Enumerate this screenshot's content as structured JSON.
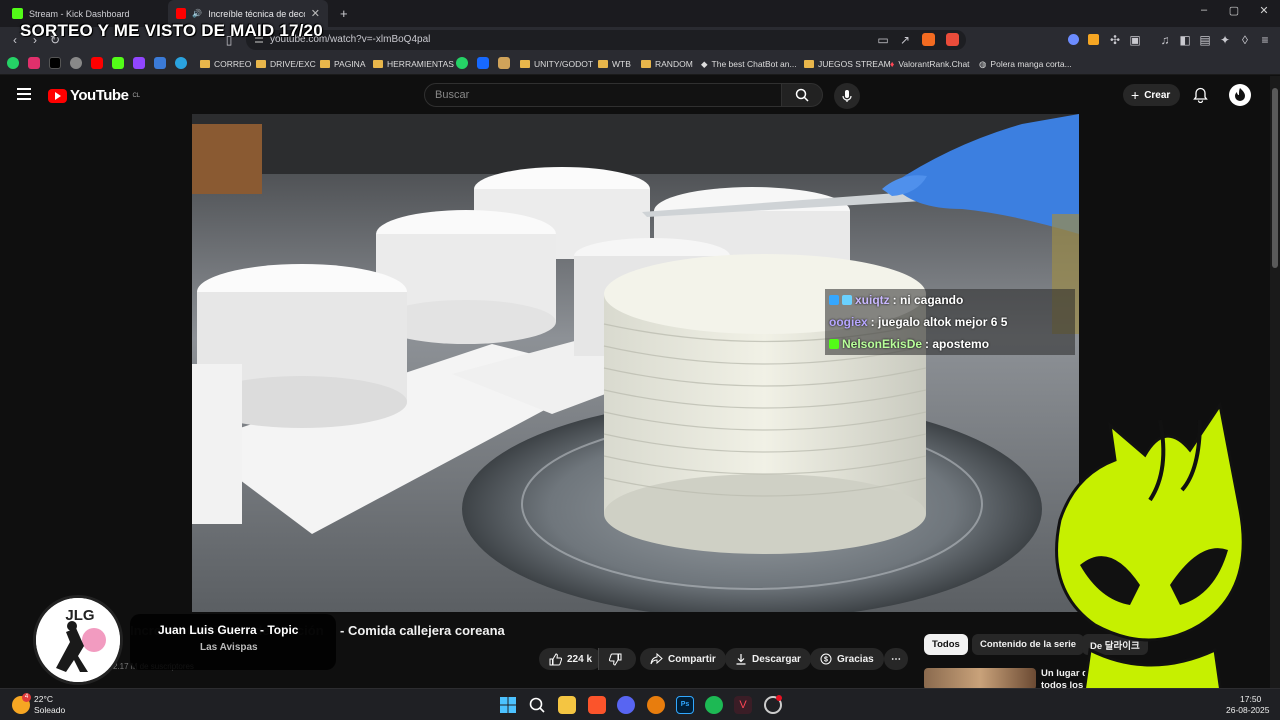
{
  "browser": {
    "tabs": [
      {
        "label": "Stream - Kick Dashboard",
        "favicon_color": "#53fc18"
      },
      {
        "label": "Increíble técnica de decoraci",
        "favicon_color": "#ff0000"
      }
    ],
    "new_tab": "+",
    "url": "youtube.com/watch?v=-xlmBoQ4pal",
    "window_controls": {
      "minimize": "–",
      "maximize": "▢",
      "close": "✕"
    },
    "bookmarks": [
      {
        "label": "CORREO"
      },
      {
        "label": "DRIVE/EXC"
      },
      {
        "label": "PAGINA"
      },
      {
        "label": "HERRAMIENTAS"
      },
      {
        "label": "UNITY/GODOT"
      },
      {
        "label": "WTB"
      },
      {
        "label": "RANDOM"
      },
      {
        "label": "The best ChatBot an..."
      },
      {
        "label": "JUEGOS STREAM"
      },
      {
        "label": "ValorantRank.Chat"
      },
      {
        "label": "Polera manga corta..."
      }
    ]
  },
  "overlay": {
    "title": "SORTEO Y ME VISTO DE MAID 17/20"
  },
  "youtube": {
    "logo_text": "YouTube",
    "logo_region": "CL",
    "search_placeholder": "Buscar",
    "create_label": "Crear",
    "video_title": "- Comida callejera coreana",
    "subscribers": "2.17 M de suscriptores",
    "actions": {
      "likes": "224 k",
      "share": "Compartir",
      "download": "Descargar",
      "thanks": "Gracias",
      "more": "⋯"
    },
    "chips": [
      {
        "label": "Todos",
        "active": true
      },
      {
        "label": "Contenido de la serie",
        "active": false
      },
      {
        "label": "De 달라이크",
        "active": false
      }
    ],
    "recommended_title": "Un lugar que todos los c..."
  },
  "chat": [
    {
      "user": "xuiqtz",
      "message": ": ni cagando",
      "badge_color": "#35a7ff"
    },
    {
      "user": "oogiex",
      "message": ": juegalo altok mejor 6 5",
      "badge_color": ""
    },
    {
      "user": "NelsonEkisDe",
      "message": ": apostemo",
      "badge_color": "#53fc18"
    }
  ],
  "now_playing": {
    "logo": "JLG",
    "artist_label": "Juan Luis Guerra - Topic",
    "song": "Las Avispas"
  },
  "taskbar": {
    "weather_temp": "22°C",
    "weather_desc": "Soleado",
    "weather_badge": "4",
    "time": "17:50",
    "date": "26-08-2025"
  },
  "colors": {
    "youtube_red": "#ff0000",
    "kick_green": "#53fc18",
    "mascot_lime": "#c6f000"
  }
}
